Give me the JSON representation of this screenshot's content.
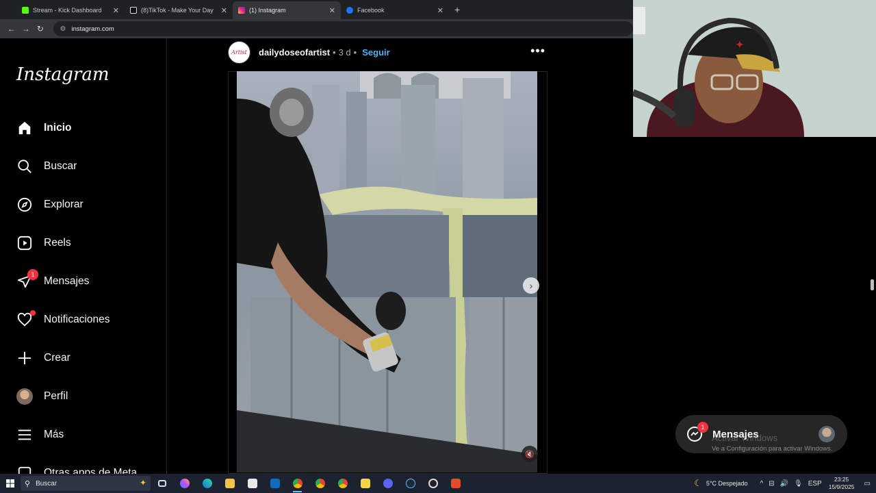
{
  "browser": {
    "tabs": [
      {
        "title": "Stream - Kick Dashboard",
        "favicon_color": "#53fc18",
        "active": false
      },
      {
        "title": "(8)TikTok - Make Your Day",
        "favicon_color": "#ffffff",
        "active": false
      },
      {
        "title": "(1) Instagram",
        "favicon_color": "#e1306c",
        "active": true
      },
      {
        "title": "Facebook",
        "favicon_color": "#1877f2",
        "active": false
      }
    ],
    "url": "instagram.com"
  },
  "sidebar": {
    "logo": "Instagram",
    "items": [
      {
        "label": "Inicio",
        "icon": "home-icon",
        "bold": true
      },
      {
        "label": "Buscar",
        "icon": "search-icon"
      },
      {
        "label": "Explorar",
        "icon": "compass-icon"
      },
      {
        "label": "Reels",
        "icon": "reels-icon"
      },
      {
        "label": "Mensajes",
        "icon": "messenger-icon",
        "badge": "1"
      },
      {
        "label": "Notificaciones",
        "icon": "heart-icon",
        "dot": true
      },
      {
        "label": "Crear",
        "icon": "plus-icon"
      },
      {
        "label": "Perfil",
        "icon": "profile-avatar"
      },
      {
        "label": "Más",
        "icon": "menu-icon"
      },
      {
        "label": "Otras apps de Meta",
        "icon": "meta-apps-icon"
      }
    ]
  },
  "post": {
    "username": "dailydoseofartist",
    "avatar_text": "Artist",
    "separator": "•",
    "time": "3 d",
    "follow": "Seguir",
    "more": "•••"
  },
  "messages_widget": {
    "label": "Mensajes",
    "badge": "1"
  },
  "watermark": {
    "line1": "Activar Windows",
    "line2": "Ve a Configuración para activar Windows."
  },
  "taskbar": {
    "search_placeholder": "Buscar",
    "weather": "5°C  Despejado",
    "language": "ESP",
    "time": "23:25",
    "date": "15/9/2025",
    "accent": "#1c2230"
  }
}
